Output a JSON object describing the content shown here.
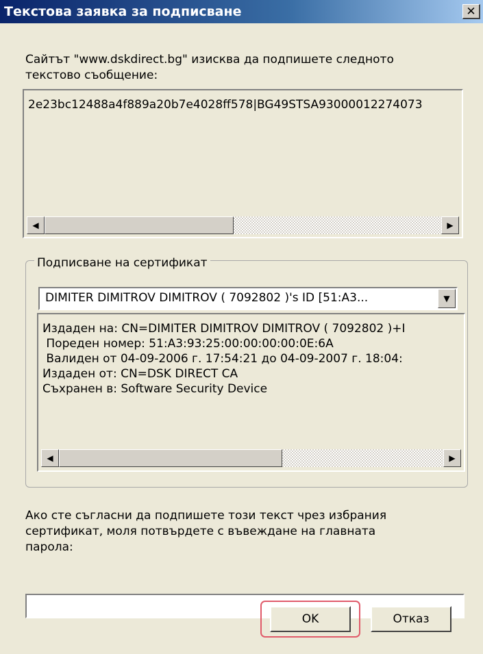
{
  "title": "Текстова заявка за подписване",
  "close_icon": "close-icon",
  "intro_line1": "Сайтът \"www.dskdirect.bg\" изисква да подпишете следното",
  "intro_line2": "текстово съобщение:",
  "message_text": "2e23bc12488a4f889a20b7e4028ff578|BG49STSA93000012274073",
  "cert_group_label": "Подписване на сертификат",
  "cert_selected": "DIMITER DIMITROV DIMITROV ( 7092802 )'s  ID [51:A3...",
  "cert_details": [
    "Издаден на: CN=DIMITER DIMITROV DIMITROV ( 7092802 )+I",
    " Пореден номер: 51:A3:93:25:00:00:00:00:0E:6A",
    " Валиден от 04-09-2006 г. 17:54:21 до 04-09-2007 г. 18:04:",
    "Издаден от: CN=DSK DIRECT CA",
    "Съхранен в: Software Security Device"
  ],
  "prompt_line1": "Ако сте съгласни да подпишете този текст чрез избрания",
  "prompt_line2": "сертификат, моля потвърдете с въвеждане на главната",
  "prompt_line3": "парола:",
  "password_value": "",
  "ok_label": "OK",
  "cancel_label": "Отказ",
  "icons": {
    "scroll_left": "◀",
    "scroll_right": "▶",
    "dropdown": "▼",
    "close": "✕"
  },
  "colors": {
    "titlebar": "#0a246a",
    "highlight_ring": "#e05a6a"
  }
}
